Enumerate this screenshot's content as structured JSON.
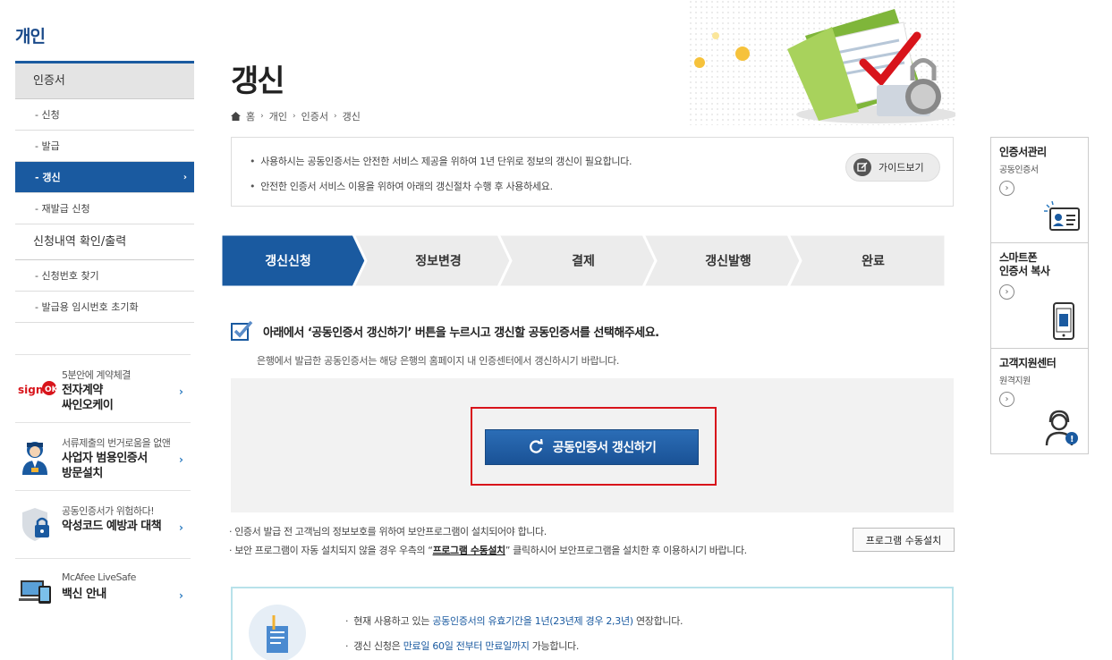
{
  "site": {
    "title": "개인"
  },
  "lnb": {
    "items": [
      {
        "label": "인증서",
        "type": "head"
      },
      {
        "label": "- 신청",
        "type": "sub"
      },
      {
        "label": "- 발급",
        "type": "sub"
      },
      {
        "label": "- 갱신",
        "type": "sub",
        "active": true
      },
      {
        "label": "- 재발급 신청",
        "type": "sub"
      },
      {
        "label": "신청내역 확인/출력",
        "type": "head2"
      },
      {
        "label": "- 신청번호 찾기",
        "type": "sub"
      },
      {
        "label": "- 발급용 임시번호 초기화",
        "type": "sub"
      }
    ]
  },
  "banners": [
    {
      "small": "5분안에 계약체결",
      "big1": "전자계약",
      "big2": "싸인오케이",
      "icon": "sign-ok-logo"
    },
    {
      "small": "서류제출의 번거로움을 없앤",
      "big1": "사업자 범용인증서",
      "big2": "방문설치",
      "icon": "agent-person-icon"
    },
    {
      "small": "공동인증서가 위험하다!",
      "big1": "악성코드 예방과 대책",
      "big2": "",
      "icon": "shield-lock-icon"
    },
    {
      "small": "McAfee LiveSafe",
      "big1": "백신 안내",
      "big2": "",
      "icon": "devices-icon"
    }
  ],
  "page": {
    "title": "갱신"
  },
  "breadcrumb": {
    "home": "홈",
    "b1": "개인",
    "b2": "인증서",
    "b3": "갱신"
  },
  "notice": {
    "line1": "사용하시는 공동인증서는 안전한 서비스 제공을 위하여 1년 단위로 정보의 갱신이 필요합니다.",
    "line2": "안전한 인증서 서비스 이용을 위하여 아래의 갱신절차 수행 후 사용하세요.",
    "guide_label": "가이드보기"
  },
  "steps": {
    "items": [
      "갱신신청",
      "정보변경",
      "결제",
      "갱신발행",
      "완료"
    ],
    "active_index": 0
  },
  "instruction": {
    "main": "아래에서 ‘공동인증서 갱신하기’ 버튼을 누르시고 갱신할 공동인증서를 선택해주세요.",
    "sub": "은행에서 발급한 공동인증서는 해당 은행의 홈페이지 내 인증센터에서 갱신하시기 바랍니다."
  },
  "renew_button": {
    "label": "공동인증서 갱신하기"
  },
  "warnings": {
    "line1": "· 인증서 발급 전 고객님의 정보보호를 위하여 보안프로그램이 설치되어야 합니다.",
    "line2_pre": "· 보안 프로그램이 자동 설치되지 않을 경우 우측의 “",
    "line2_link": "프로그램 수동설치",
    "line2_post": "” 클릭하시어 보안프로그램을 설치한 후 이용하시기 바랍니다.",
    "manual_button": "프로그램 수동설치"
  },
  "info": {
    "l1_pre": "현재 사용하고 있는 ",
    "l1_hl": "공동인증서의 유효기간을 1년(23년제 경우 2,3년)",
    "l1_post": " 연장합니다.",
    "l2_pre": "갱신 신청은 ",
    "l2_hl": "만료일 60일 전부터 만료일까지",
    "l2_post": " 가능합니다."
  },
  "quick": [
    {
      "title1": "인증서관리",
      "title2": "",
      "sub": "공동인증서",
      "icon": "id-card-icon"
    },
    {
      "title1": "스마트폰",
      "title2": "인증서 복사",
      "sub": "",
      "icon": "smartphone-icon"
    },
    {
      "title1": "고객지원센터",
      "title2": "",
      "sub": "원격지원",
      "icon": "headset-support-icon"
    }
  ],
  "colors": {
    "brand": "#1a5aa0",
    "highlight_frame": "#d8141b",
    "step_inactive": "#ececec"
  }
}
